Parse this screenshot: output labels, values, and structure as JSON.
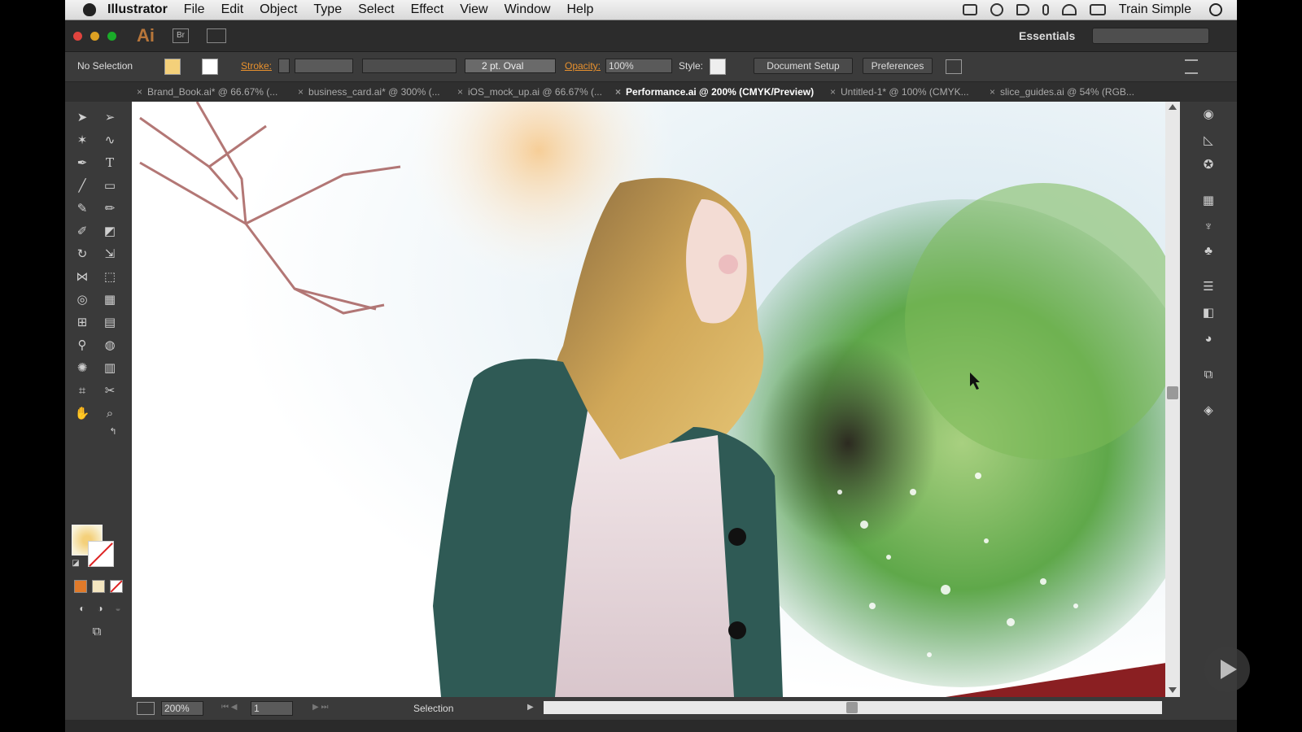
{
  "menubar": {
    "app_name": "Illustrator",
    "items": [
      "File",
      "Edit",
      "Object",
      "Type",
      "Select",
      "Effect",
      "View",
      "Window",
      "Help"
    ],
    "user": "Train Simple"
  },
  "appbar": {
    "logo": "Ai",
    "bridge_label": "Br",
    "workspace": "Essentials",
    "search_placeholder": ""
  },
  "control": {
    "selection": "No Selection",
    "stroke_label": "Stroke:",
    "brush": "2 pt. Oval",
    "opacity_label": "Opacity:",
    "opacity_value": "100%",
    "style_label": "Style:",
    "document_setup": "Document Setup",
    "preferences": "Preferences"
  },
  "tabs": [
    {
      "label": "Brand_Book.ai* @ 66.67% (...",
      "active": false
    },
    {
      "label": "business_card.ai* @ 300% (...",
      "active": false
    },
    {
      "label": "iOS_mock_up.ai @ 66.67% (...",
      "active": false
    },
    {
      "label": "Performance.ai @ 200% (CMYK/Preview)",
      "active": true
    },
    {
      "label": "Untitled-1* @ 100% (CMYK...",
      "active": false
    },
    {
      "label": "slice_guides.ai @ 54% (RGB...",
      "active": false
    }
  ],
  "status": {
    "zoom": "200%",
    "page": "1",
    "tool": "Selection"
  },
  "colors": {
    "fill": "#f4d07a",
    "accent_orange": "#e8912e",
    "tree_green": "#5fa84a",
    "jacket": "#2f5a55",
    "hair": "#c99a4e"
  }
}
